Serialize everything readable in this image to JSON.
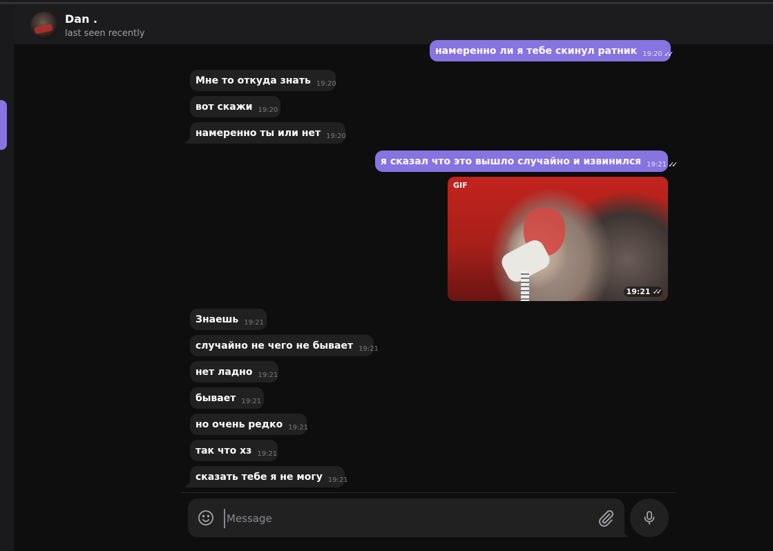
{
  "header": {
    "name": "Dan .",
    "status": "last seen recently"
  },
  "messages": [
    {
      "dir": "out",
      "text": "намеренно ли я тебе скинул ратник",
      "time": "19:20",
      "read": true
    },
    {
      "dir": "in",
      "text": "Мне то откуда знать",
      "time": "19:20"
    },
    {
      "dir": "in",
      "text": "вот скажи",
      "time": "19:20"
    },
    {
      "dir": "in",
      "text": "намеренно ты или нет",
      "time": "19:20"
    },
    {
      "dir": "out",
      "text": "я сказал что это вышло случайно и извинился",
      "time": "19:21",
      "read": true
    },
    {
      "dir": "in",
      "text": "Знаешь",
      "time": "19:21"
    },
    {
      "dir": "in",
      "text": "случайно не чего не бывает",
      "time": "19:21"
    },
    {
      "dir": "in",
      "text": "нет ладно",
      "time": "19:21"
    },
    {
      "dir": "in",
      "text": "бывает",
      "time": "19:21"
    },
    {
      "dir": "in",
      "text": "но очень редко",
      "time": "19:21"
    },
    {
      "dir": "in",
      "text": "так что хз",
      "time": "19:21"
    },
    {
      "dir": "in",
      "text": "сказать тебе я не могу",
      "time": "19:21"
    }
  ],
  "gif": {
    "label": "GIF",
    "time": "19:21",
    "read": true
  },
  "composer": {
    "placeholder": "Message"
  },
  "icons": {
    "emoji": "smile-icon",
    "attach": "paperclip-icon",
    "mic": "microphone-icon",
    "read": "double-check-icon"
  },
  "colors": {
    "accent": "#8774e1",
    "bubble_in": "#212121",
    "background": "#0e0e0f"
  }
}
